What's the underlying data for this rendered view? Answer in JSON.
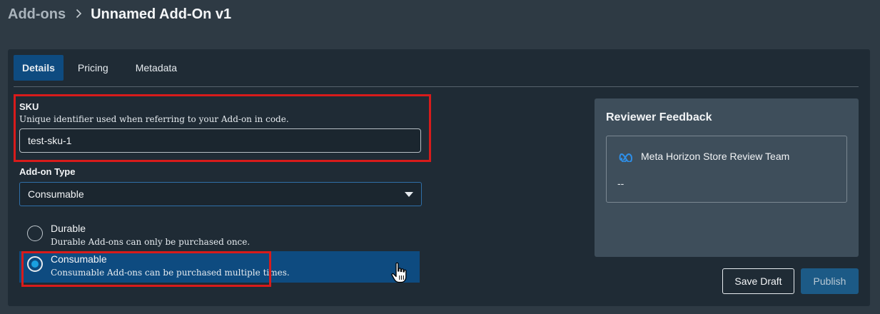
{
  "breadcrumb": {
    "parent": "Add-ons",
    "separator": ">",
    "current": "Unnamed Add-On v1"
  },
  "tabs": [
    {
      "label": "Details",
      "active": true
    },
    {
      "label": "Pricing",
      "active": false
    },
    {
      "label": "Metadata",
      "active": false
    }
  ],
  "sku": {
    "label": "SKU",
    "help": "Unique identifier used when referring to your Add-on in code.",
    "value": "test-sku-1"
  },
  "addon_type": {
    "label": "Add-on Type",
    "selected": "Consumable",
    "options": [
      {
        "title": "Durable",
        "description": "Durable Add-ons can only be purchased once.",
        "checked": false
      },
      {
        "title": "Consumable",
        "description": "Consumable Add-ons can be purchased multiple times.",
        "checked": true
      }
    ]
  },
  "feedback": {
    "title": "Reviewer Feedback",
    "author": "Meta Horizon Store Review Team",
    "text": "--"
  },
  "buttons": {
    "save_draft": "Save Draft",
    "publish": "Publish"
  },
  "colors": {
    "accent": "#0e4b80",
    "radio_dot": "#1aa0e0",
    "highlight_box": "#d81b1b"
  },
  "icons": {
    "breadcrumb_sep": "chevron-right-icon",
    "select_caret": "caret-down-icon",
    "brand": "meta-logo-icon",
    "cursor": "hand-pointer-icon"
  }
}
